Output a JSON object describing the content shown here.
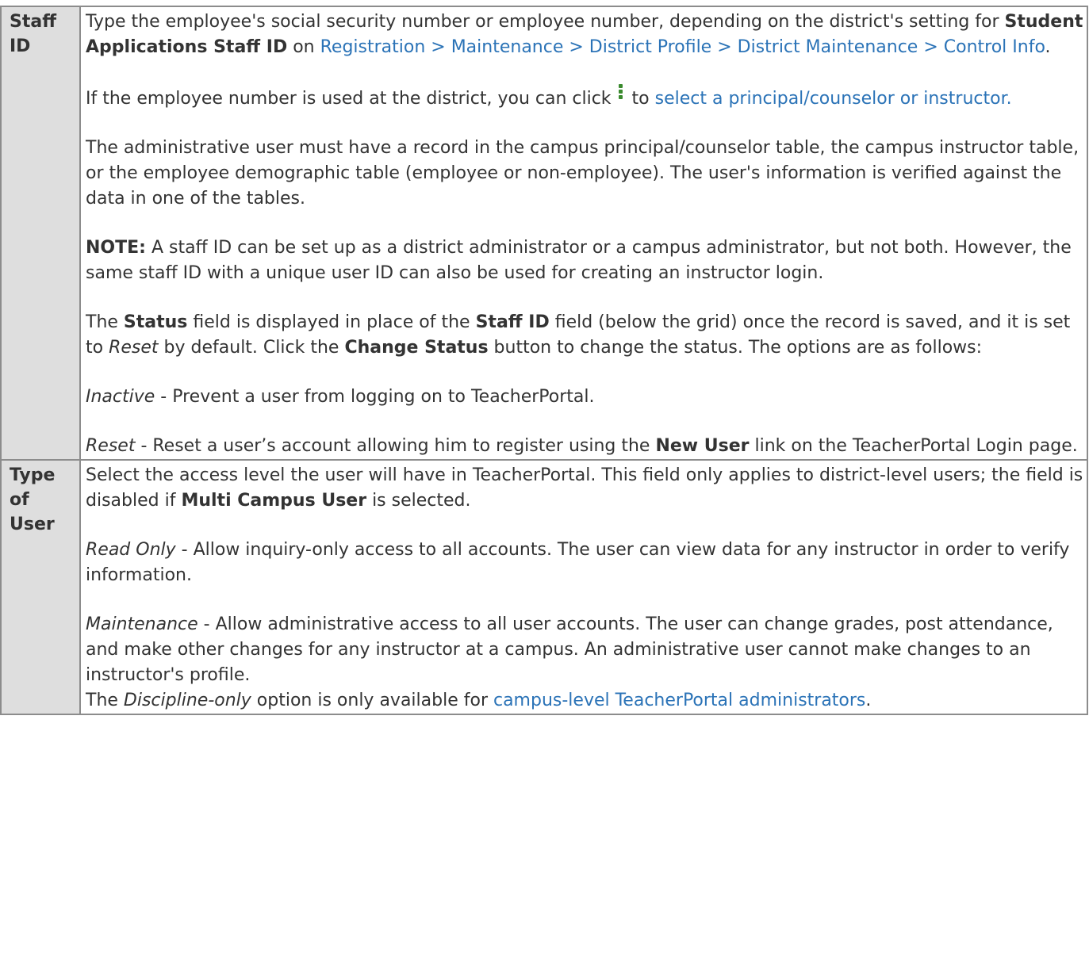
{
  "rows": [
    {
      "label": "Staff ID",
      "p1": {
        "t1": "Type the employee's social security number or employee number, depending on the district's setting for ",
        "b1": "Student Applications Staff ID",
        "t2": " on ",
        "link": "Registration > Maintenance > District Profile > District Maintenance > Control Info",
        "t3": "."
      },
      "p2": {
        "t1": "If the employee number is used at the district, you can click ",
        "icon": "kebab-menu-icon",
        "t2": " to ",
        "link": "select a principal/counselor or instructor."
      },
      "p3": "The administrative user must have a record in the campus principal/counselor table, the campus instructor table, or the employee demographic table (employee or non-employee). The user's information is verified against the data in one of the tables.",
      "p4": {
        "b1": "NOTE:",
        "t1": " A staff ID can be set up as a district administrator or a campus administrator, but not both. However, the same staff ID with a unique user ID can also be used for creating an instructor login."
      },
      "p5": {
        "t1": "The ",
        "b1": "Status",
        "t2": " field is displayed in place of the ",
        "b2": "Staff ID",
        "t3": " field (below the grid) once the record is saved, and it is set to ",
        "i1": "Reset",
        "t4": " by default. Click the ",
        "b3": "Change Status",
        "t5": " button to change the status. The options are as follows:"
      },
      "p6": {
        "i1": "Inactive",
        "t1": " - Prevent a user from logging on to TeacherPortal."
      },
      "p7": {
        "i1": "Reset",
        "t1": " - Reset a user’s account allowing him to register using the ",
        "b1": "New User",
        "t2": " link on the TeacherPortal Login page."
      }
    },
    {
      "label": "Type of User",
      "p1": {
        "t1": "Select the access level the user will have in TeacherPortal. This field only applies to district-level users; the field is disabled if ",
        "b1": "Multi Campus User",
        "t2": " is selected."
      },
      "p2": {
        "i1": "Read Only",
        "t1": " - Allow inquiry-only access to all accounts. The user can view data for any instructor in order to verify information."
      },
      "p3": {
        "i1": "Maintenance",
        "t1": " - Allow administrative access to all user accounts. The user can change grades, post attendance, and make other changes for any instructor at a campus. An administrative user cannot make changes to an instructor's profile."
      },
      "p4": {
        "t1": "The ",
        "i1": "Discipline-only",
        "t2": " option is only available for ",
        "link": "campus-level TeacherPortal administrators",
        "t3": "."
      }
    }
  ],
  "colors": {
    "link": "#2b73b7",
    "label_bg": "#dedede",
    "border": "#8c8c8c",
    "icon": "#3a8a2e"
  }
}
